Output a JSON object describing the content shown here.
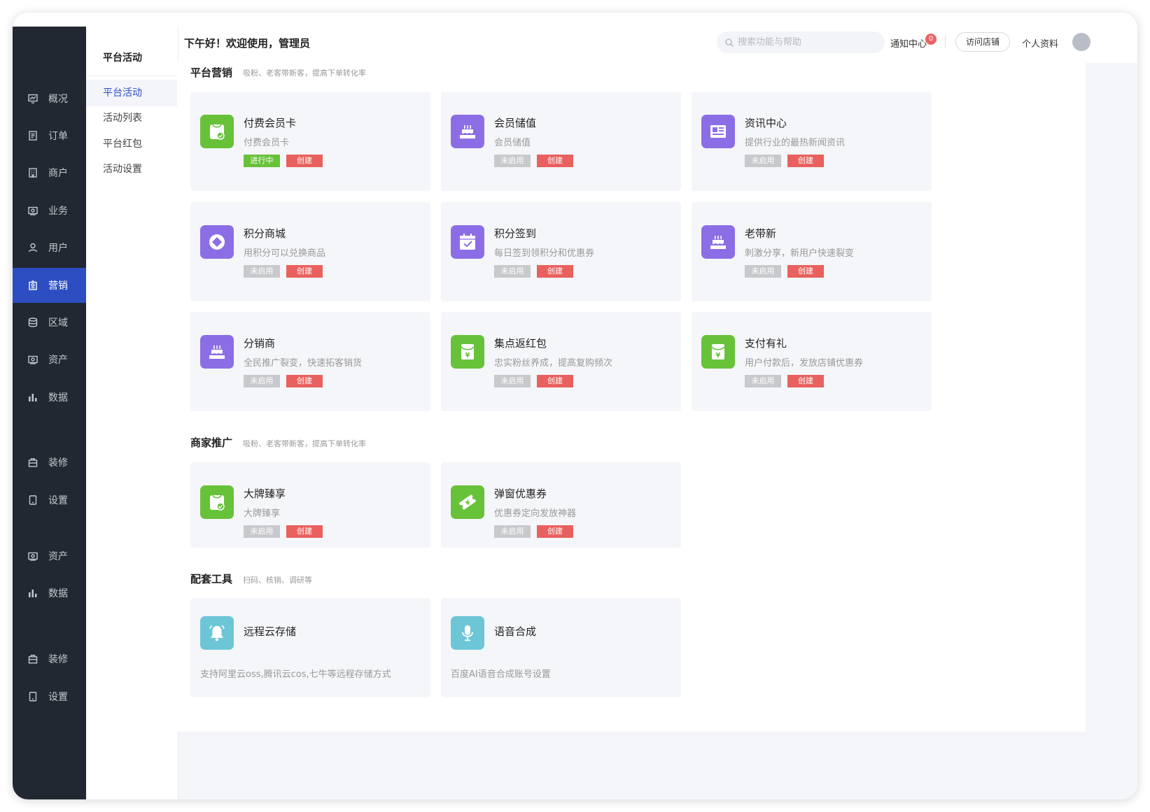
{
  "colors": {
    "sidebar_bg": "#222831",
    "active_blue": "#2d4ec2",
    "green": "#67c23a",
    "purple": "#8b6ee6",
    "red": "#e8615e",
    "teal": "#6cc6d6"
  },
  "sidebar": {
    "items": [
      {
        "label": "概况",
        "icon": "trend-chart-icon",
        "active": false
      },
      {
        "label": "订单",
        "icon": "document-icon",
        "active": false
      },
      {
        "label": "商户",
        "icon": "building-icon",
        "active": false
      },
      {
        "label": "业务",
        "icon": "wallet-icon",
        "active": false
      },
      {
        "label": "用户",
        "icon": "user-icon",
        "active": false
      },
      {
        "label": "营销",
        "icon": "tag-icon",
        "active": true
      },
      {
        "label": "区域",
        "icon": "database-icon",
        "active": false
      },
      {
        "label": "资产",
        "icon": "wallet-icon",
        "active": false
      },
      {
        "label": "数据",
        "icon": "bar-chart-icon",
        "active": false
      },
      {
        "label": "装修",
        "icon": "bag-icon",
        "active": false
      },
      {
        "label": "设置",
        "icon": "phone-icon",
        "active": false
      },
      {
        "label": "资产",
        "icon": "wallet-icon",
        "active": false
      },
      {
        "label": "数据",
        "icon": "bar-chart-icon",
        "active": false
      },
      {
        "label": "装修",
        "icon": "bag-icon",
        "active": false
      },
      {
        "label": "设置",
        "icon": "phone-icon",
        "active": false
      }
    ]
  },
  "subnav": {
    "title": "平台活动",
    "items": [
      {
        "label": "平台活动",
        "active": true
      },
      {
        "label": "活动列表",
        "active": false
      },
      {
        "label": "平台红包",
        "active": false
      },
      {
        "label": "活动设置",
        "active": false
      }
    ]
  },
  "header": {
    "greeting": "下午好！欢迎使用，管理员",
    "search_placeholder": "搜索功能与帮助",
    "notify_label": "通知中心",
    "notify_count": "0",
    "visit_store": "访问店铺",
    "profile": "个人资料"
  },
  "sections": {
    "platform": {
      "title": "平台营销",
      "subtitle": "吸粉、老客带新客，提高下单转化率",
      "cards": [
        {
          "name": "付费会员卡",
          "desc": "付费会员卡",
          "status": "进行中",
          "create": "创建",
          "icon": "vip-card-icon",
          "color": "#67c23a"
        },
        {
          "name": "会员储值",
          "desc": "会员储值",
          "status": "未启用",
          "create": "创建",
          "icon": "cake-icon",
          "color": "#8b6ee6"
        },
        {
          "name": "资讯中心",
          "desc": "提供行业的最热新闻资讯",
          "status": "未启用",
          "create": "创建",
          "icon": "news-icon",
          "color": "#8b6ee6"
        },
        {
          "name": "积分商城",
          "desc": "用积分可以兑换商品",
          "status": "未启用",
          "create": "创建",
          "icon": "diamond-icon",
          "color": "#8b6ee6"
        },
        {
          "name": "积分签到",
          "desc": "每日签到领积分和优惠券",
          "status": "未启用",
          "create": "创建",
          "icon": "calendar-check-icon",
          "color": "#8b6ee6"
        },
        {
          "name": "老带新",
          "desc": "刺激分享，新用户快速裂变",
          "status": "未启用",
          "create": "创建",
          "icon": "cake-icon",
          "color": "#8b6ee6"
        },
        {
          "name": "分销商",
          "desc": "全民推广裂变，快速拓客销货",
          "status": "未启用",
          "create": "创建",
          "icon": "cake-icon",
          "color": "#8b6ee6"
        },
        {
          "name": "集点返红包",
          "desc": "忠实粉丝养成，提高复购频次",
          "status": "未启用",
          "create": "创建",
          "icon": "red-packet-icon",
          "color": "#67c23a"
        },
        {
          "name": "支付有礼",
          "desc": "用户付款后，发放店铺优惠券",
          "status": "未启用",
          "create": "创建",
          "icon": "red-packet-icon",
          "color": "#67c23a"
        }
      ]
    },
    "merchant": {
      "title": "商家推广",
      "subtitle": "吸粉、老客带新客，提高下单转化率",
      "cards": [
        {
          "name": "大牌臻享",
          "desc": "大牌臻享",
          "status": "未启用",
          "create": "创建",
          "icon": "vip-card-icon",
          "color": "#67c23a"
        },
        {
          "name": "弹窗优惠券",
          "desc": "优惠券定向发放神器",
          "status": "未启用",
          "create": "创建",
          "icon": "coupon-icon",
          "color": "#67c23a"
        }
      ]
    },
    "tools": {
      "title": "配套工具",
      "subtitle": "扫码、核销、调研等",
      "cards": [
        {
          "name": "远程云存储",
          "desc": "支持阿里云oss,腾讯云cos,七牛等远程存储方式",
          "icon": "bell-icon",
          "color": "#6cc6d6"
        },
        {
          "name": "语音合成",
          "desc": "百度AI语音合成账号设置",
          "icon": "microphone-icon",
          "color": "#6cc6d6"
        }
      ]
    }
  }
}
